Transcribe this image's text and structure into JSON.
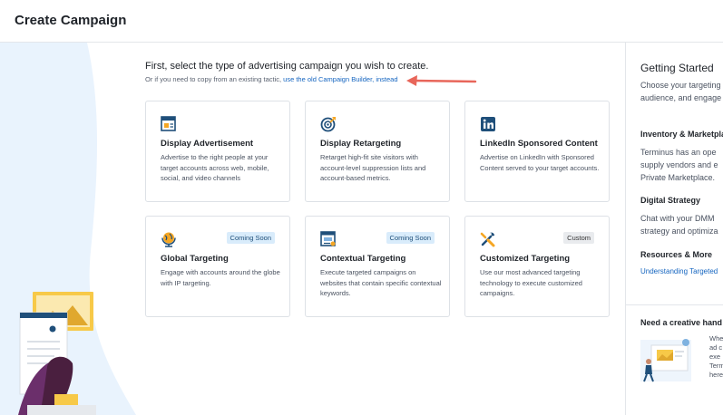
{
  "header": {
    "title": "Create Campaign"
  },
  "intro": {
    "text": "First, select the type of advertising campaign you wish to create.",
    "sub_prefix": "Or if you need to copy from an existing tactic,",
    "sub_link": "use the old Campaign Builder, instead"
  },
  "cards": [
    {
      "title": "Display Advertisement",
      "description": "Advertise to the right people at your target accounts across web, mobile, social, and video channels",
      "badge": ""
    },
    {
      "title": "Display Retargeting",
      "description": "Retarget high-fit site visitors with account-level suppression lists and account-based metrics.",
      "badge": ""
    },
    {
      "title": "LinkedIn Sponsored Content",
      "description": "Advertise on LinkedIn with Sponsored Content served to your target accounts.",
      "badge": ""
    },
    {
      "title": "Global Targeting",
      "description": "Engage with accounts around the globe with IP targeting.",
      "badge": "Coming Soon"
    },
    {
      "title": "Contextual Targeting",
      "description": "Execute targeted campaigns on websites that contain specific contextual keywords.",
      "badge": "Coming Soon"
    },
    {
      "title": "Customized Targeting",
      "description": "Use our most advanced targeting technology to execute customized campaigns.",
      "badge": "Custom"
    }
  ],
  "panel": {
    "title": "Getting Started",
    "intro_line1": "Choose your targeting",
    "intro_line2": "audience, and engage",
    "inventory_heading": "Inventory & Marketpla",
    "inventory_line1": "Terminus has an ope",
    "inventory_line2": "supply vendors and e",
    "inventory_line3": "Private Marketplace.",
    "digital_heading": "Digital Strategy",
    "digital_line1": "Chat with your DMM",
    "digital_line2": "strategy and optimiza",
    "resources_heading": "Resources & More",
    "resources_link": "Understanding Targeted",
    "creative_heading": "Need a creative hand",
    "creative_line1": "Whe",
    "creative_line2": "ad c",
    "creative_line3": "exe",
    "creative_line4": "Term",
    "creative_line5": "here"
  },
  "colors": {
    "accent": "#1565c0",
    "arrow": "#e8665a",
    "badge_blue": "#d9ecfb",
    "background_shape": "#e9f3fd"
  }
}
